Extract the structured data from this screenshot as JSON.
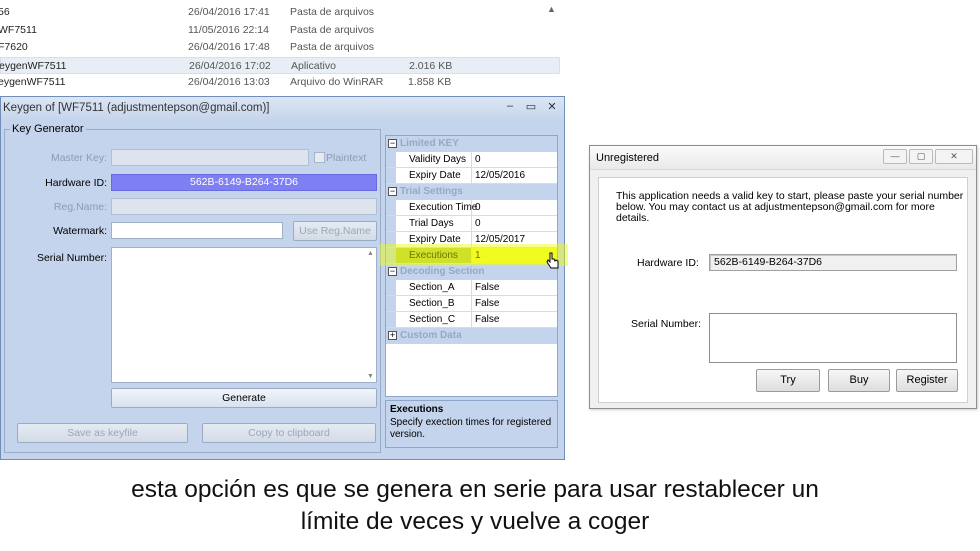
{
  "files": [
    {
      "name": "56",
      "date": "26/04/2016 17:41",
      "type": "Pasta de arquivos",
      "size": ""
    },
    {
      "name": "WF7511",
      "date": "11/05/2016 22:14",
      "type": "Pasta de arquivos",
      "size": ""
    },
    {
      "name": "F7620",
      "date": "26/04/2016 17:48",
      "type": "Pasta de arquivos",
      "size": ""
    },
    {
      "name": "eygenWF7511",
      "date": "26/04/2016 17:02",
      "type": "Aplicativo",
      "size": "2.016 KB"
    },
    {
      "name": "eygenWF7511",
      "date": "26/04/2016 13:03",
      "type": "Arquivo do WinRAR",
      "size": "1.858 KB"
    }
  ],
  "keygen": {
    "title": "Keygen of [WF7511 (adjustmentepson@gmail.com)]",
    "group_label": "Key Generator",
    "master_key_label": "Master Key:",
    "plaintext_label": "Plaintext",
    "hardware_id_label": "Hardware ID:",
    "hardware_id_value": "562B-6149-B264-37D6",
    "reg_name_label": "Reg.Name:",
    "watermark_label": "Watermark:",
    "use_reg_name_button": "Use Reg.Name",
    "serial_number_label": "Serial Number:",
    "generate_button": "Generate",
    "save_keyfile_button": "Save as keyfile",
    "copy_clipboard_button": "Copy to clipboard",
    "properties": {
      "limited_key": {
        "label": "Limited KEY",
        "validity_days_label": "Validity Days",
        "validity_days_value": "0",
        "expiry_date_label": "Expiry Date",
        "expiry_date_value": "12/05/2016"
      },
      "trial_settings": {
        "label": "Trial Settings",
        "execution_time_label": "Execution Time",
        "execution_time_value": "0",
        "trial_days_label": "Trial Days",
        "trial_days_value": "0",
        "expiry_date_label": "Expiry Date",
        "expiry_date_value": "12/05/2017",
        "executions_label": "Executions",
        "executions_value": "1"
      },
      "decoding_section": {
        "label": "Decoding Section",
        "section_a_label": "Section_A",
        "section_a_value": "False",
        "section_b_label": "Section_B",
        "section_b_value": "False",
        "section_c_label": "Section_C",
        "section_c_value": "False"
      },
      "custom_data": {
        "label": "Custom Data"
      }
    },
    "help": {
      "title": "Executions",
      "description": "Specify exection times for registered version."
    }
  },
  "unregistered": {
    "title": "Unregistered",
    "message": "This application needs a valid key to start, please paste your serial number below. You may contact us at adjustmentepson@gmail.com for more details.",
    "hardware_id_label": "Hardware ID:",
    "hardware_id_value": "562B-6149-B264-37D6",
    "serial_number_label": "Serial Number:",
    "try_button": "Try",
    "buy_button": "Buy",
    "register_button": "Register"
  },
  "subtitle": {
    "line1": "esta opción es que se genera en serie para usar restablecer un",
    "line2": "límite de veces y vuelve a coger"
  },
  "colors": {
    "hardware_id_bg": "#7f7ff4",
    "highlight_marker": "#eeff00",
    "keygen_bg": "#c4d4ec"
  }
}
